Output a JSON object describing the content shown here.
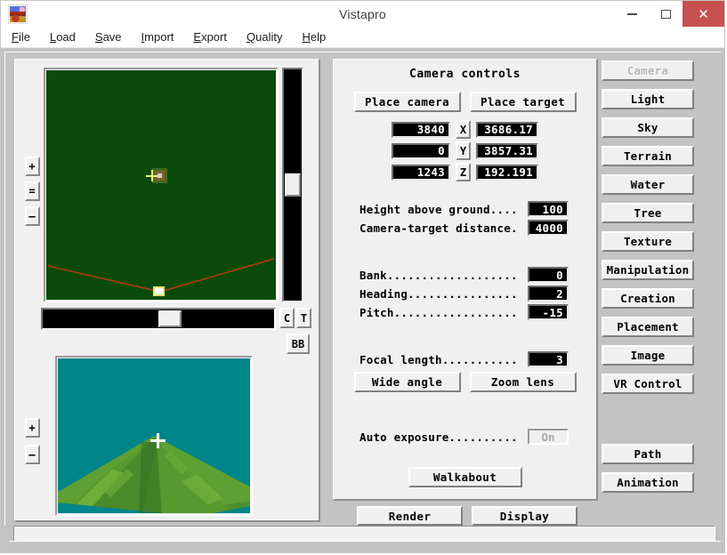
{
  "window": {
    "title": "Vistapro",
    "app_icon": "landscape-icon",
    "minimize": "–",
    "maximize": "□",
    "close": "✕"
  },
  "menubar": {
    "items": [
      {
        "label": "File",
        "accel": "F"
      },
      {
        "label": "Load",
        "accel": "L"
      },
      {
        "label": "Save",
        "accel": "S"
      },
      {
        "label": "Import",
        "accel": "I"
      },
      {
        "label": "Export",
        "accel": "E"
      },
      {
        "label": "Quality",
        "accel": "Q"
      },
      {
        "label": "Help",
        "accel": "H"
      }
    ]
  },
  "map_panel": {
    "zoom_in": "+",
    "zoom_reset": "=",
    "zoom_out": "–",
    "colors": {
      "terrain": "#0a4a0a",
      "ridge_line": "#b03c14",
      "camera_marker_border": "#3e6b23",
      "camera_marker_fill": "#8a5a2b",
      "target_marker": "#efe26a"
    },
    "side_buttons": [
      {
        "label": "C"
      },
      {
        "label": "T"
      },
      {
        "label": "BB"
      }
    ]
  },
  "preview_panel": {
    "zoom_in": "+",
    "zoom_out": "–",
    "colors": {
      "sky": "#00858a",
      "water": "#00858a",
      "terrain_light": "#6aa832",
      "terrain_mid": "#4e9030",
      "terrain_dark": "#3d7a2a",
      "crosshair": "#ffffff"
    }
  },
  "camera_panel": {
    "title": "Camera controls",
    "place_camera_label": "Place camera",
    "place_target_label": "Place target",
    "axes": [
      "X",
      "Y",
      "Z"
    ],
    "camera_position": [
      "3840",
      "0",
      "1243"
    ],
    "target_position": [
      "3686.17",
      "3857.31",
      "192.191"
    ],
    "rows": [
      {
        "label": "Height above ground....",
        "value": "100"
      },
      {
        "label": "Camera-target distance.",
        "value": "4000"
      }
    ],
    "orientation": [
      {
        "label": "Bank...................",
        "value": "0"
      },
      {
        "label": "Heading................",
        "value": "2"
      },
      {
        "label": "Pitch..................",
        "value": "-15"
      }
    ],
    "focal": {
      "label": "Focal length...........",
      "value": "3"
    },
    "wide_angle_label": "Wide angle",
    "zoom_lens_label": "Zoom lens",
    "auto_exposure": {
      "label": "Auto exposure..........",
      "value": "On"
    },
    "walkabout_label": "Walkabout"
  },
  "action_buttons": {
    "render_label": "Render",
    "display_label": "Display"
  },
  "sidebar": {
    "items": [
      {
        "label": "Camera",
        "disabled": true
      },
      {
        "label": "Light",
        "disabled": false
      },
      {
        "label": "Sky",
        "disabled": false
      },
      {
        "label": "Terrain",
        "disabled": false
      },
      {
        "label": "Water",
        "disabled": false
      },
      {
        "label": "Tree",
        "disabled": false
      },
      {
        "label": "Texture",
        "disabled": false
      },
      {
        "label": "Manipulation",
        "disabled": false
      },
      {
        "label": "Creation",
        "disabled": false
      },
      {
        "label": "Placement",
        "disabled": false
      },
      {
        "label": "Image",
        "disabled": false
      },
      {
        "label": "VR Control",
        "disabled": false
      }
    ],
    "items_lower": [
      {
        "label": "Path",
        "disabled": false
      },
      {
        "label": "Animation",
        "disabled": false
      }
    ]
  },
  "statusbar": {
    "text": ""
  }
}
